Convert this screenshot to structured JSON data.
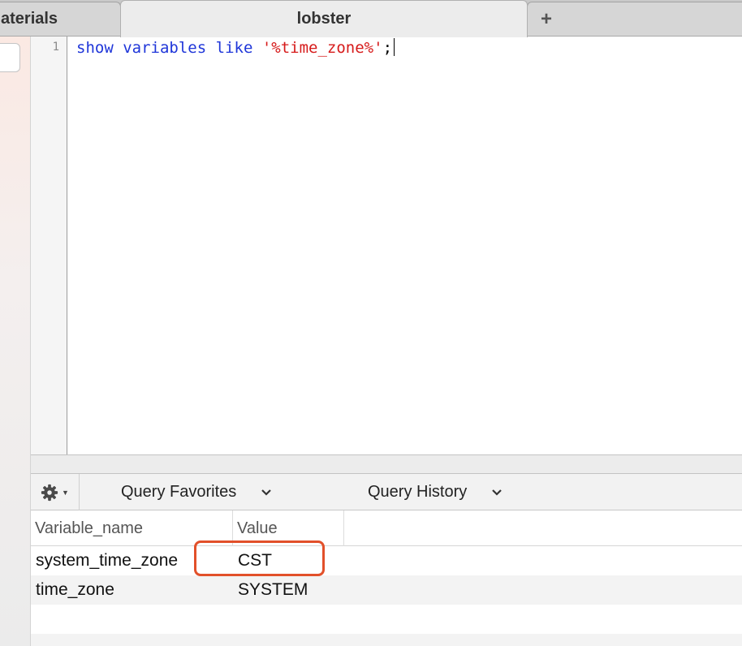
{
  "tabs": [
    {
      "label": "aterials"
    },
    {
      "label": "lobster"
    },
    {
      "label": "+"
    }
  ],
  "editor": {
    "line_number": "1",
    "code": {
      "kw_show": "show",
      "kw_variables": "variables",
      "kw_like": "like",
      "string": "'%time_zone%'",
      "punct": ";"
    }
  },
  "query_toolbar": {
    "gear_icon": "gear-icon",
    "favorites_label": "Query Favorites",
    "history_label": "Query History"
  },
  "results": {
    "columns": [
      "Variable_name",
      "Value"
    ],
    "rows": [
      [
        "system_time_zone",
        "CST"
      ],
      [
        "time_zone",
        "SYSTEM"
      ]
    ]
  },
  "colors": {
    "keyword": "#1f36d9",
    "string": "#d61a1a",
    "highlight": "#e2502a"
  }
}
